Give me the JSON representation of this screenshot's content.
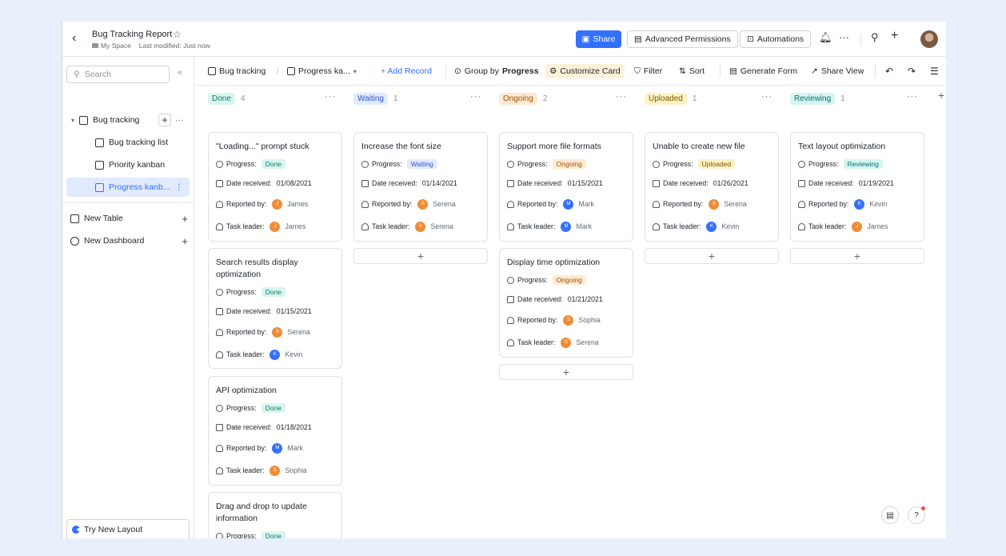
{
  "header": {
    "title": "Bug Tracking Report",
    "location": "My Space",
    "modified": "Last modified: Just now",
    "share": "Share",
    "advanced_permissions": "Advanced Permissions",
    "automations": "Automations"
  },
  "sidebar": {
    "search_placeholder": "Search",
    "table": "Bug tracking",
    "views": [
      "Bug tracking list",
      "Priority kanban",
      "Progress kanb..."
    ],
    "new_table": "New Table",
    "new_dashboard": "New Dashboard",
    "try_layout": "Try New Layout"
  },
  "toolbar": {
    "table": "Bug tracking",
    "view": "Progress ka...",
    "add_record": "+ Add Record",
    "group_prefix": "Group by",
    "group_field": "Progress",
    "customize": "Customize Card",
    "filter": "Filter",
    "sort": "Sort",
    "generate_form": "Generate Form",
    "share_view": "Share View"
  },
  "labels": {
    "progress": "Progress:",
    "date": "Date received:",
    "reported": "Reported by:",
    "leader": "Task leader:"
  },
  "colors": {
    "accent": "#3370ff",
    "done_bg": "#d9f5ef",
    "done_fg": "#117b6a",
    "waiting_bg": "#e1eaff",
    "waiting_fg": "#2f54c7",
    "ongoing_bg": "#feead2",
    "ongoing_fg": "#a35100",
    "uploaded_bg": "#fdf2c4",
    "uploaded_fg": "#7a5a00",
    "reviewing_bg": "#d5f6f2",
    "reviewing_fg": "#0f6b6b"
  },
  "columns": [
    {
      "name": "Done",
      "count": "4"
    },
    {
      "name": "Waiting",
      "count": "1"
    },
    {
      "name": "Ongoing",
      "count": "2"
    },
    {
      "name": "Uploaded",
      "count": "1"
    },
    {
      "name": "Reviewing",
      "count": "1"
    }
  ],
  "cards": {
    "done": [
      {
        "title": "\"Loading...\" prompt stuck",
        "progress": "Done",
        "date": "01/08/2021",
        "reporter": "James",
        "reporter_initial": "J",
        "leader": "James",
        "leader_initial": "J"
      },
      {
        "title": "Search results display optimization",
        "progress": "Done",
        "date": "01/15/2021",
        "reporter": "Serena",
        "reporter_initial": "S",
        "leader": "Kevin",
        "leader_initial": "K"
      },
      {
        "title": "API optimization",
        "progress": "Done",
        "date": "01/18/2021",
        "reporter": "Mark",
        "reporter_initial": "M",
        "leader": "Sophia",
        "leader_initial": "S"
      },
      {
        "title": "Drag and drop to update information",
        "progress": "Done"
      }
    ],
    "waiting": [
      {
        "title": "Increase the font size",
        "progress": "Waiting",
        "date": "01/14/2021",
        "reporter": "Serena",
        "reporter_initial": "S",
        "leader": "Serena",
        "leader_initial": "S"
      }
    ],
    "ongoing": [
      {
        "title": "Support more file formats",
        "progress": "Ongoing",
        "date": "01/15/2021",
        "reporter": "Mark",
        "reporter_initial": "M",
        "leader": "Mark",
        "leader_initial": "M"
      },
      {
        "title": "Display time optimization",
        "progress": "Ongoing",
        "date": "01/21/2021",
        "reporter": "Sophia",
        "reporter_initial": "S",
        "leader": "Serena",
        "leader_initial": "S"
      }
    ],
    "uploaded": [
      {
        "title": "Unable to create new file",
        "progress": "Uploaded",
        "date": "01/26/2021",
        "reporter": "Serena",
        "reporter_initial": "S",
        "leader": "Kevin",
        "leader_initial": "K"
      }
    ],
    "reviewing": [
      {
        "title": "Text layout optimization",
        "progress": "Reviewing",
        "date": "01/19/2021",
        "reporter": "Kevin",
        "reporter_initial": "K",
        "leader": "James",
        "leader_initial": "J"
      }
    ]
  },
  "add_symbol": "+"
}
